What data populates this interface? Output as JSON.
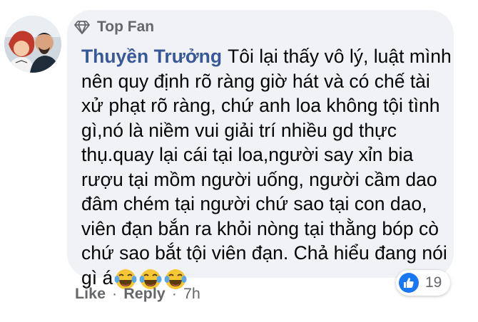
{
  "comment": {
    "badge": "Top Fan",
    "author": "Thuyền Trưởng",
    "text": "Tôi lại thấy vô lý, luật mình nên quy định rõ ràng giờ hát và có chế tài xử phạt rõ ràng, chứ anh loa không tội tình gì,nó là niềm vui giải trí nhiều gd thực thụ.quay lại cái tại loa,người say xỉn bia rượu tại mồm người uống, người cầm dao đâm chém tại người chứ sao tại con dao, viên đạn bắn ra khỏi nòng tại thằng bóp cò chứ sao bắt tội viên đạn. Chả hiểu đang nói gì á",
    "emojis": [
      "laughing-tears-emoji",
      "laughing-tears-emoji",
      "laughing-tears-emoji"
    ],
    "reaction_icon": "like-icon",
    "reaction_count": "19"
  },
  "actions": {
    "like_label": "Like",
    "reply_label": "Reply",
    "separator": "·",
    "timestamp": "7h"
  },
  "colors": {
    "author": "#385898",
    "bubble": "#f0f2f5",
    "like_blue": "#1877f2",
    "muted": "#65676b"
  }
}
